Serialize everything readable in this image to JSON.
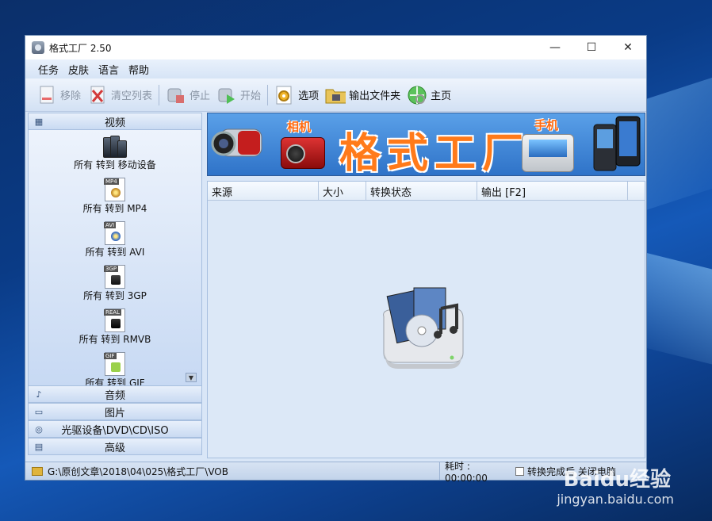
{
  "window": {
    "title": "格式工厂 2.50",
    "minimize": "—",
    "maximize": "☐",
    "close": "✕"
  },
  "menu": [
    "任务",
    "皮肤",
    "语言",
    "帮助"
  ],
  "toolbar": {
    "remove": "移除",
    "clear_list": "清空列表",
    "stop": "停止",
    "start": "开始",
    "options": "选项",
    "output_folder": "输出文件夹",
    "home": "主页"
  },
  "sidebar": {
    "video_header": "视频",
    "items": [
      {
        "label": "所有 转到 移动设备",
        "tag": ""
      },
      {
        "label": "所有 转到 MP4",
        "tag": "MP4"
      },
      {
        "label": "所有 转到 AVI",
        "tag": "AVI"
      },
      {
        "label": "所有 转到 3GP",
        "tag": "3GP"
      },
      {
        "label": "所有 转到 RMVB",
        "tag": "REAL"
      },
      {
        "label": "所有 转到 GIF",
        "tag": "GIF"
      }
    ],
    "audio_header": "音频",
    "picture_header": "图片",
    "rom_header": "光驱设备\\DVD\\CD\\ISO",
    "advanced_header": "高级"
  },
  "banner": {
    "title": "格式工厂",
    "camera_label": "相机",
    "phone_label": "手机"
  },
  "list": {
    "columns": [
      "来源",
      "大小",
      "转换状态",
      "输出 [F2]"
    ]
  },
  "status": {
    "path": "G:\\原创文章\\2018\\04\\025\\格式工厂\\VOB",
    "elapsed": "耗时 : 00:00:00",
    "after_convert": "转换完成后 关闭电脑"
  },
  "watermark": {
    "main": "Baidu经验",
    "sub": "jingyan.baidu.com"
  }
}
